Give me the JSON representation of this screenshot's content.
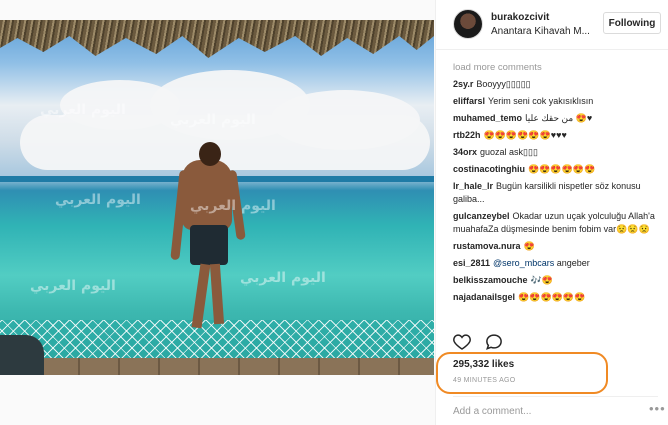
{
  "post": {
    "username": "burakozcivit",
    "location": "Anantara Kihavah M...",
    "follow_label": "Following"
  },
  "watermark_text": "اليوم العربي",
  "comments": {
    "load_more": "load more comments",
    "items": [
      {
        "user": "2sy.r",
        "text": "Booyyy▯▯▯▯▯"
      },
      {
        "user": "eliffarsl",
        "text": "Yerim seni cok yakısıklısın"
      },
      {
        "user": "muhamed_temo",
        "text": "من حقك عليا 😍♥"
      },
      {
        "user": "rtb22h",
        "text": "😍😍😍😍😍😍♥♥♥"
      },
      {
        "user": "34orx",
        "text": "guozal ask▯▯▯"
      },
      {
        "user": "costinacotinghiu",
        "text": "😍😍😍😍😍😍"
      },
      {
        "user": "lr_hale_lr",
        "text": "Bugün karsilikli nispetler söz konusu galiba..."
      },
      {
        "user": "gulcanzeybel",
        "text": "Okadar uzun uçak yolculuğu Allah'a muahafaZa düşmesinde benim fobim var😟😟😟"
      },
      {
        "user": "rustamova.nura",
        "text": "😍"
      },
      {
        "user": "esi_2811",
        "mention": "@sero_mbcars",
        "text": "angeber"
      },
      {
        "user": "belkisszamouche",
        "text": "🎶😍"
      },
      {
        "user": "najadanailsgel",
        "text": "😍😍😍😍😍😍"
      }
    ]
  },
  "likes": "295,332 likes",
  "time_ago": "49 MINUTES AGO",
  "add_comment_placeholder": "Add a comment...",
  "more_label": "•••",
  "colors": {
    "highlight": "#f08a24",
    "mention": "#003569"
  }
}
